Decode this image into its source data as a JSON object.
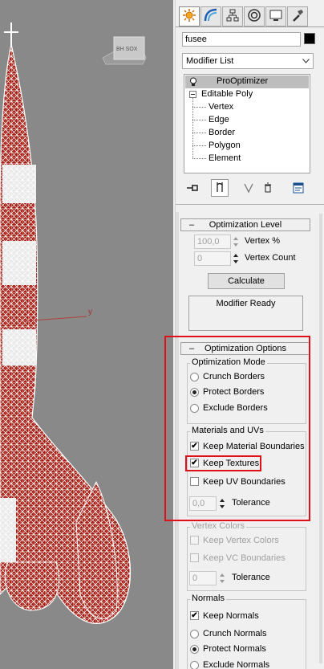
{
  "viewport": {
    "label": "BH SOX",
    "axis_label": "y",
    "background": "#898989",
    "mesh_color": "#a61e14",
    "wire_color": "#ffffff"
  },
  "tabs": [
    {
      "icon": "sun-icon",
      "active": true
    },
    {
      "icon": "curve-icon",
      "active": false
    },
    {
      "icon": "hierarchy-icon",
      "active": false
    },
    {
      "icon": "motion-icon",
      "active": false
    },
    {
      "icon": "monitor-icon",
      "active": false
    },
    {
      "icon": "hammer-icon",
      "active": false
    }
  ],
  "object_name": "fusee",
  "object_color": "#000000",
  "modifier_list": "Modifier List",
  "stack": {
    "selected": "ProOptimizer",
    "base": "Editable Poly",
    "sub_objects": [
      "Vertex",
      "Edge",
      "Border",
      "Polygon",
      "Element"
    ]
  },
  "optimization_level": {
    "header": "Optimization Level",
    "collapse": "–",
    "vertex_pct_value": "100,0",
    "vertex_pct_label": "Vertex %",
    "vertex_count_value": "0",
    "vertex_count_label": "Vertex Count",
    "calculate_label": "Calculate",
    "status": "Modifier Ready"
  },
  "optimization_options": {
    "header": "Optimization Options",
    "collapse": "–",
    "mode_group": "Optimization Mode",
    "modes": [
      {
        "label": "Crunch Borders",
        "checked": false
      },
      {
        "label": "Protect Borders",
        "checked": true
      },
      {
        "label": "Exclude Borders",
        "checked": false
      }
    ],
    "materials_group": "Materials and UVs",
    "keep_material_boundaries": "Keep Material Boundaries",
    "keep_textures": "Keep Textures",
    "keep_uv_boundaries": "Keep UV Boundaries",
    "uv_tolerance_value": "0,0",
    "uv_tolerance_label": "Tolerance",
    "vertex_colors_group": "Vertex Colors",
    "keep_vertex_colors": "Keep Vertex Colors",
    "keep_vc_boundaries": "Keep VC Boundaries",
    "vc_tolerance_value": "0",
    "vc_tolerance_label": "Tolerance",
    "normals_group": "Normals",
    "keep_normals": "Keep Normals",
    "normal_modes": [
      {
        "label": "Crunch Normals",
        "checked": false
      },
      {
        "label": "Protect Normals",
        "checked": true
      },
      {
        "label": "Exclude Normals",
        "checked": false
      }
    ]
  },
  "check_mark": "✔",
  "highlight_color": "#e0101a"
}
